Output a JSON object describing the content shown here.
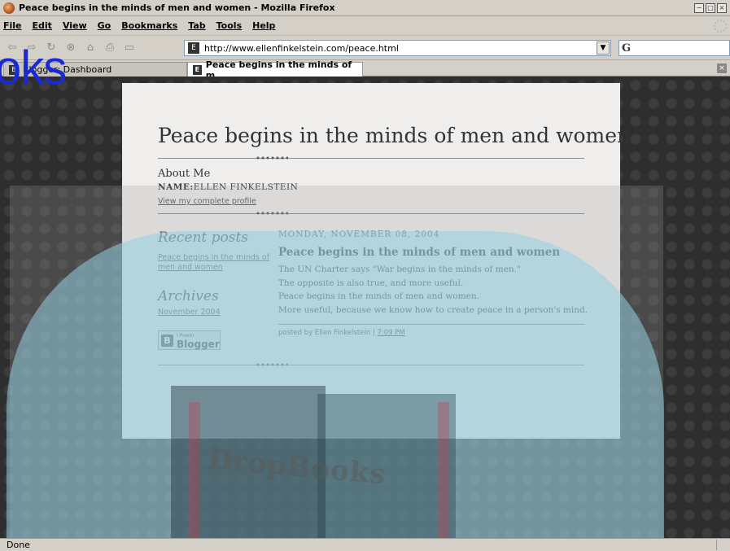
{
  "window": {
    "title": "Peace begins in the minds of men and women - Mozilla Firefox",
    "buttons": [
      "−",
      "□",
      "×"
    ]
  },
  "menu": {
    "items": [
      "File",
      "Edit",
      "View",
      "Go",
      "Bookmarks",
      "Tab",
      "Tools",
      "Help"
    ]
  },
  "nav": {
    "url": "http://www.ellenfinkelstein.com/peace.html",
    "search_value": ""
  },
  "tabs": [
    {
      "label": "Blogger: Dashboard"
    },
    {
      "label": "Peace begins in the minds of m..."
    }
  ],
  "blog": {
    "title": "Peace begins in the minds of men and women",
    "about_heading": "About Me",
    "name_label": "NAME:",
    "name_value": "ELLEN FINKELSTEIN",
    "profile_link": "View my complete profile",
    "recent_posts_heading": "Recent posts",
    "recent_post_link": "Peace begins in the minds of men and women",
    "archives_heading": "Archives",
    "archive_link": "November 2004",
    "blogger_badge_small": "I Power",
    "blogger_badge_big": "Blogger",
    "post": {
      "date": "MONDAY, NOVEMBER 08, 2004",
      "title": "Peace begins in the minds of men and women",
      "body_lines": [
        "The UN Charter says \"War begins in the minds of men.\"",
        "The opposite is also true, and more useful.",
        "Peace begins in the minds of men and women.",
        "More useful, because we know how to create peace in a person's mind."
      ],
      "posted_by": "posted by Ellen Finkelstein |",
      "time": "7:09 PM"
    }
  },
  "overlay": {
    "logo_fragment": "oks",
    "watermark_word": "DropBooks"
  },
  "status": {
    "text": "Done"
  }
}
